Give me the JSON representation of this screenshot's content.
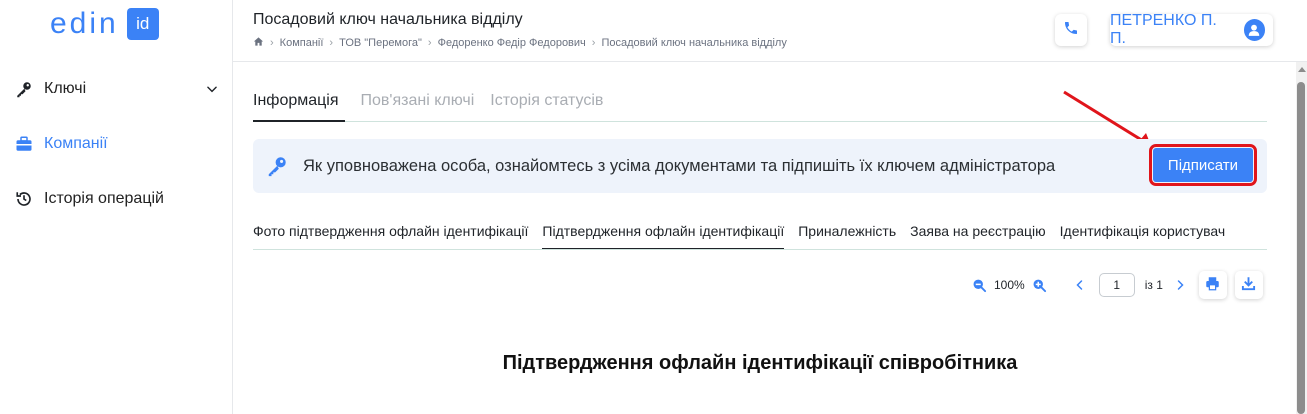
{
  "sidebar": {
    "logo_text": "edin",
    "logo_badge": "id",
    "items": [
      {
        "label": "Ключі",
        "icon": "key-icon"
      },
      {
        "label": "Компанії",
        "icon": "briefcase-icon"
      },
      {
        "label": "Історія операцій",
        "icon": "history-icon"
      }
    ]
  },
  "header": {
    "title": "Посадовий ключ начальника відділу",
    "breadcrumb": [
      "Компанії",
      "ТОВ \"Перемога\"",
      "Федоренко Федір Федорович",
      "Посадовий ключ начальника відділу"
    ],
    "user_label": "ПЕТРЕНКО П. П."
  },
  "tabs": [
    {
      "label": "Інформація",
      "active": true
    },
    {
      "label": "Пов'язані ключі",
      "active": false
    },
    {
      "label": "Історія статусів",
      "active": false
    }
  ],
  "notice": {
    "message": "Як уповноважена особа, ознайомтесь з усіма документами та підпишіть їх ключем адміністратора",
    "sign_button": "Підписати"
  },
  "doc_tabs": [
    {
      "label": "Фото підтвердження офлайн ідентифікації",
      "active": false
    },
    {
      "label": "Підтвердження офлайн ідентифікації",
      "active": true
    },
    {
      "label": "Приналежність",
      "active": false
    },
    {
      "label": "Заява на реєстрацію",
      "active": false
    },
    {
      "label": "Ідентифікація користувач",
      "active": false
    }
  ],
  "viewer": {
    "zoom": "100%",
    "page": "1",
    "page_total": "із 1"
  },
  "document": {
    "heading": "Підтвердження офлайн ідентифікації співробітника"
  },
  "colors": {
    "accent": "#3b82f6",
    "highlight": "#e0151b"
  }
}
